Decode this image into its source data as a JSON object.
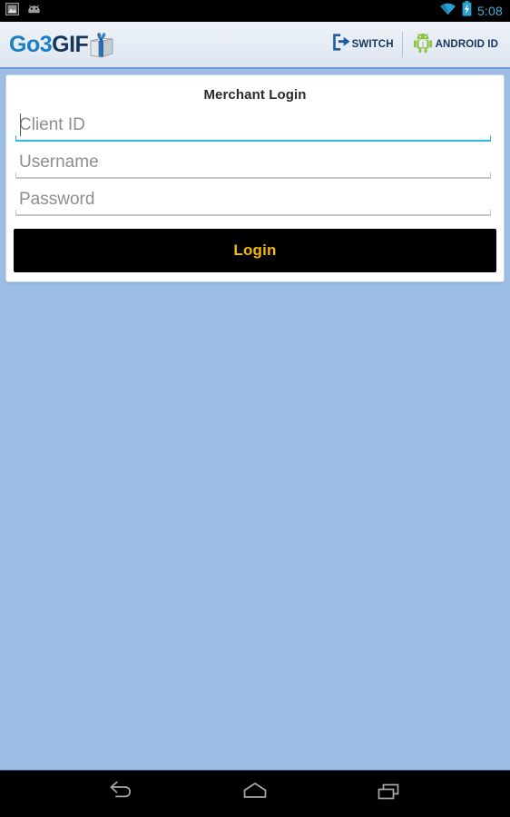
{
  "status_bar": {
    "left_icons": [
      {
        "name": "gallery-image-icon",
        "label": "Image"
      },
      {
        "name": "android-notification-icon",
        "label": "Android"
      }
    ],
    "right_icons": [
      {
        "name": "wifi-icon",
        "label": "Wi-Fi"
      },
      {
        "name": "battery-charging-icon",
        "label": "Battery charging"
      }
    ],
    "time": "5:08",
    "time_color": "#39B3D7",
    "background_color": "#000000"
  },
  "app_header": {
    "logo": {
      "name": "go3gift-logo",
      "text_primary": "Go3",
      "text_secondary": "GIF",
      "icon_name": "gift-box-icon",
      "primary_color": "#1B7FC4",
      "secondary_color": "#16355C"
    },
    "actions": [
      {
        "name": "switch-action",
        "label": "SWITCH",
        "icon_name": "switch-account-icon"
      },
      {
        "name": "android-id-action",
        "label": "ANDROID ID",
        "icon_name": "android-robot-icon"
      }
    ],
    "background_color": "#E8EDF5",
    "divider_color": "#6E9BD1"
  },
  "login_card": {
    "title": "Merchant Login",
    "fields": [
      {
        "name": "client-id-field",
        "placeholder": "Client ID",
        "value": "",
        "focused": true,
        "type": "text"
      },
      {
        "name": "username-field",
        "placeholder": "Username",
        "value": "",
        "focused": false,
        "type": "text"
      },
      {
        "name": "password-field",
        "placeholder": "Password",
        "value": "",
        "focused": false,
        "type": "password"
      }
    ],
    "submit_button": {
      "name": "login-button",
      "label": "Login",
      "background_color": "#000000",
      "text_color": "#F5B800"
    }
  },
  "background": {
    "page_color": "#9CBEE5"
  },
  "nav_bar": {
    "buttons": [
      {
        "name": "nav-back-button",
        "label": "Back"
      },
      {
        "name": "nav-home-button",
        "label": "Home"
      },
      {
        "name": "nav-recents-button",
        "label": "Recent apps"
      }
    ],
    "background_color": "#000000"
  }
}
